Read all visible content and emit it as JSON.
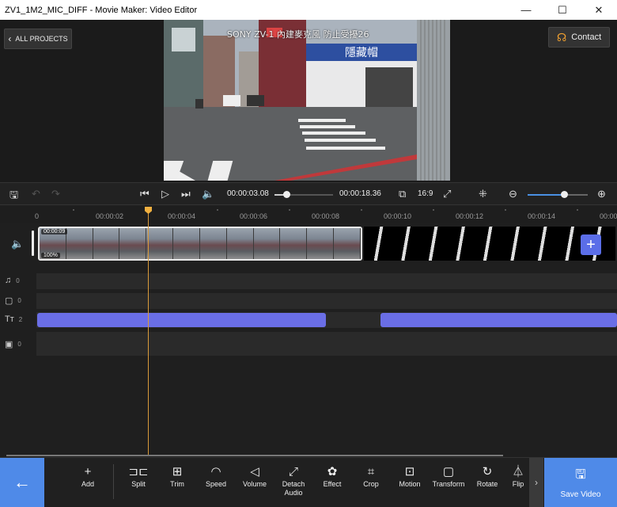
{
  "window": {
    "title": "ZV1_1M2_MIC_DIFF - Movie Maker: Video Editor",
    "minimize": "—",
    "maximize": "☐",
    "close": "✕"
  },
  "header": {
    "all_projects": "ALL PROJECTS",
    "contact": "Contact"
  },
  "preview": {
    "overlay_text": "SONY ZV-1 內建麥克風 防止受擾26"
  },
  "playback": {
    "current_time": "00:00:03.08",
    "total_time": "00:00:18.36",
    "progress": 0.2,
    "aspect_ratio": "16:9",
    "zoom_level": 0.6
  },
  "ruler": {
    "labels": [
      "0",
      "00:00:02",
      "00:00:04",
      "00:00:06",
      "00:00:08",
      "00:00:10",
      "00:00:12",
      "00:00:14",
      "00:00:1"
    ]
  },
  "tracks": {
    "video_clip": {
      "duration": "00:00:09",
      "volume": "100%"
    },
    "music": {
      "count": "0"
    },
    "sticker": {
      "count": "0"
    },
    "text": {
      "count": "2"
    },
    "image": {
      "count": "0"
    }
  },
  "toolbar": {
    "tools": [
      {
        "label": "Add",
        "icon": "+"
      },
      {
        "label": "Split",
        "icon": "⊐⊏"
      },
      {
        "label": "Trim",
        "icon": "⊞"
      },
      {
        "label": "Speed",
        "icon": "◠"
      },
      {
        "label": "Volume",
        "icon": "◁"
      },
      {
        "label": "Detach Audio",
        "icon": "⤢"
      },
      {
        "label": "Effect",
        "icon": "✿"
      },
      {
        "label": "Crop",
        "icon": "⌗"
      },
      {
        "label": "Motion",
        "icon": "⊡"
      },
      {
        "label": "Transform",
        "icon": "▢"
      },
      {
        "label": "Rotate",
        "icon": "↻"
      },
      {
        "label": "Flip",
        "icon": "⏃"
      }
    ],
    "save_video": "Save Video"
  },
  "colors": {
    "accent": "#4f8ae8",
    "text_clip": "#6a6ee6",
    "playhead": "#d99a3a"
  }
}
